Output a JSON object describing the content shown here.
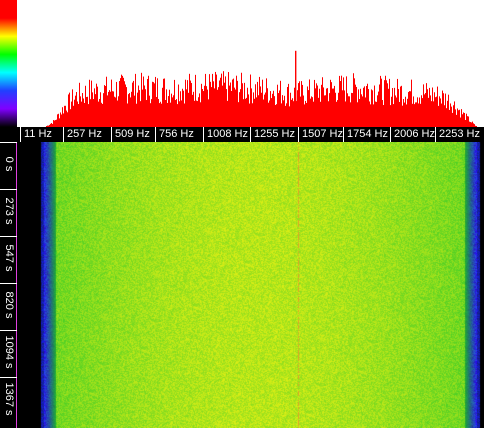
{
  "colors": {
    "spectrum_fill": "#ff0000",
    "spectrum_bg": "#ffffff",
    "axis_bg": "#000000",
    "axis_text": "#ffffff",
    "time_axis_border": "#e040e0",
    "waterfall_main": "#40e020",
    "waterfall_hot": "#d8f020",
    "waterfall_edge": "#2040ff",
    "tone_line": "#e0a020"
  },
  "colorbar_gradient": [
    "#ff0000",
    "#ff0000",
    "#ffff00",
    "#00ff00",
    "#00ffff",
    "#2040ff",
    "#8000ff",
    "#000000"
  ],
  "frequency_axis": {
    "labels": [
      "11 Hz",
      "257 Hz",
      "509 Hz",
      "756 Hz",
      "1008 Hz",
      "1255 Hz",
      "1507 Hz",
      "1754 Hz",
      "2006 Hz",
      "2253 Hz"
    ]
  },
  "time_axis": {
    "labels": [
      "0 s",
      "273 s",
      "547 s",
      "820 s",
      "1094 s",
      "1367 s"
    ]
  },
  "chart_data": {
    "type": "area",
    "x_unit": "Hz",
    "xlim": [
      11,
      2420
    ],
    "x": [
      11,
      60,
      120,
      180,
      257,
      330,
      400,
      509,
      600,
      700,
      756,
      850,
      950,
      1008,
      1100,
      1200,
      1255,
      1300,
      1380,
      1450,
      1507,
      1600,
      1700,
      1754,
      1850,
      1950,
      2006,
      2100,
      2200,
      2253,
      2330,
      2400
    ],
    "level": [
      0.0,
      0.05,
      0.18,
      0.26,
      0.3,
      0.31,
      0.32,
      0.33,
      0.33,
      0.32,
      0.33,
      0.34,
      0.34,
      0.34,
      0.33,
      0.32,
      0.31,
      0.3,
      0.28,
      0.29,
      0.3,
      0.32,
      0.33,
      0.33,
      0.32,
      0.3,
      0.3,
      0.29,
      0.26,
      0.22,
      0.1,
      0.0
    ],
    "peak": {
      "x": 1395,
      "level": 0.6
    }
  }
}
